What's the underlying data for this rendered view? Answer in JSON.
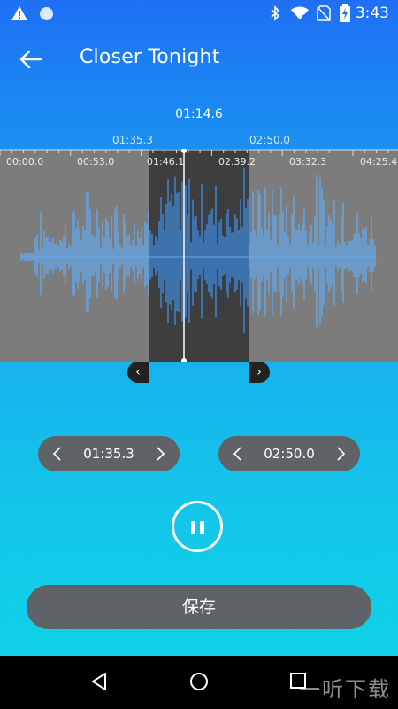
{
  "status_bar": {
    "time": "3:43",
    "icons": [
      "warning-icon",
      "sync-icon",
      "bluetooth-icon",
      "wifi-icon",
      "no-sim-icon",
      "battery-charging-icon"
    ]
  },
  "app_bar": {
    "title": "Closer Tonight",
    "back_icon": "arrow-left-icon"
  },
  "current_time": "01:14.6",
  "selection_labels": {
    "start": "01:35.3",
    "end": "02:50.0"
  },
  "timeline_ticks": [
    "00:00.0",
    "00:53.0",
    "01:46.1",
    "02.39.2",
    "03:32.3",
    "04:25.4"
  ],
  "waveform": {
    "colors": {
      "background": "#7c7c7c",
      "wave": "#62aaf2",
      "selection_bg": "#3e3e3e",
      "selection_wave": "#3e8ee8"
    },
    "duration": "04:25.4"
  },
  "start_pill": {
    "value": "01:35.3",
    "prev_icon": "chevron-left-icon",
    "next_icon": "chevron-right-icon"
  },
  "end_pill": {
    "value": "02:50.0",
    "prev_icon": "chevron-left-icon",
    "next_icon": "chevron-right-icon"
  },
  "controls": {
    "pause_icon": "pause-icon",
    "save_label": "保存"
  },
  "nav_bar": {
    "icons": [
      "back-triangle-icon",
      "home-circle-icon",
      "recents-square-icon"
    ]
  },
  "watermark": "一听下载"
}
